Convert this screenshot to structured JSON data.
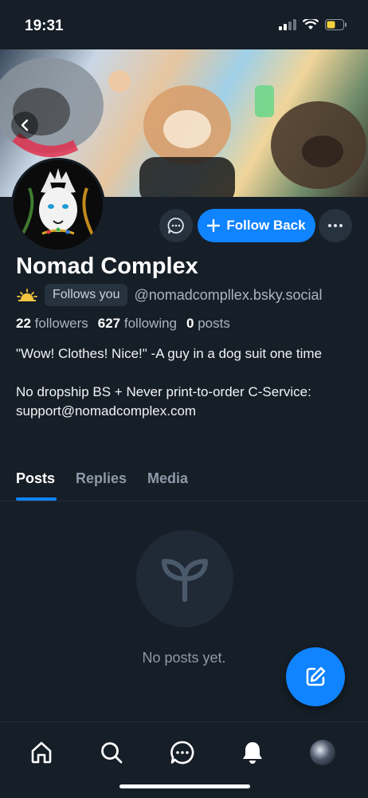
{
  "status_bar": {
    "time": "19:31"
  },
  "profile": {
    "display_name": "Nomad Complex",
    "follows_you_label": "Follows you",
    "handle": "@nomadcompllex.bsky.social",
    "followers_count": "22",
    "followers_label": "followers",
    "following_count": "627",
    "following_label": "following",
    "posts_count": "0",
    "posts_label": "posts",
    "bio_line1": "\"Wow! Clothes! Nice!\" -A guy in a dog suit one time",
    "bio_line2": "No dropship BS + Never print-to-order C-Service: support@nomadcomplex.com"
  },
  "actions": {
    "follow_back_label": "Follow Back"
  },
  "tabs": [
    {
      "label": "Posts",
      "active": true
    },
    {
      "label": "Replies",
      "active": false
    },
    {
      "label": "Media",
      "active": false
    }
  ],
  "empty_state": {
    "text": "No posts yet."
  },
  "colors": {
    "accent": "#1083fe",
    "background": "#161e27",
    "surface": "#27323f"
  },
  "icons": {
    "back": "chevron-left-icon",
    "message": "chat-bubble-icon",
    "follow": "plus-icon",
    "more": "ellipsis-icon",
    "empty": "sprout-icon",
    "compose": "compose-icon",
    "nav": [
      "home-icon",
      "search-icon",
      "chat-icon",
      "bell-icon",
      "profile-avatar"
    ]
  }
}
